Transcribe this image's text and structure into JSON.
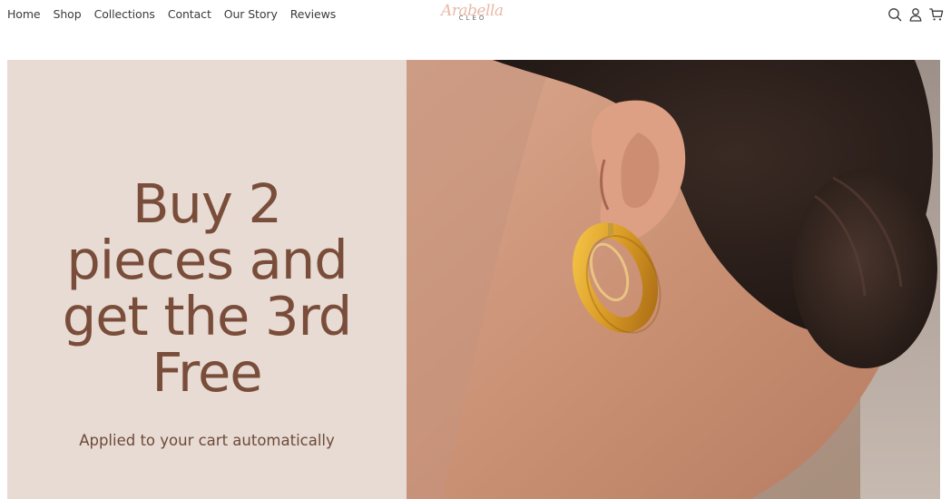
{
  "nav": {
    "items": [
      "Home",
      "Shop",
      "Collections",
      "Contact",
      "Our Story",
      "Reviews"
    ]
  },
  "logo": {
    "script": "Arabella",
    "sub": "CLEO"
  },
  "header_icons": [
    "search-icon",
    "account-icon",
    "cart-icon"
  ],
  "hero": {
    "headline_lines": [
      "Buy 2",
      "pieces and",
      "get the 3rd",
      "Free"
    ],
    "subline": "Applied to your cart automatically",
    "image_subject": "earring-model-photo"
  },
  "colors": {
    "panel_bg": "#e7dbd3",
    "headline": "#7a4d3b",
    "logo_accent": "#e8b9a8",
    "gold": "#d89a24"
  }
}
